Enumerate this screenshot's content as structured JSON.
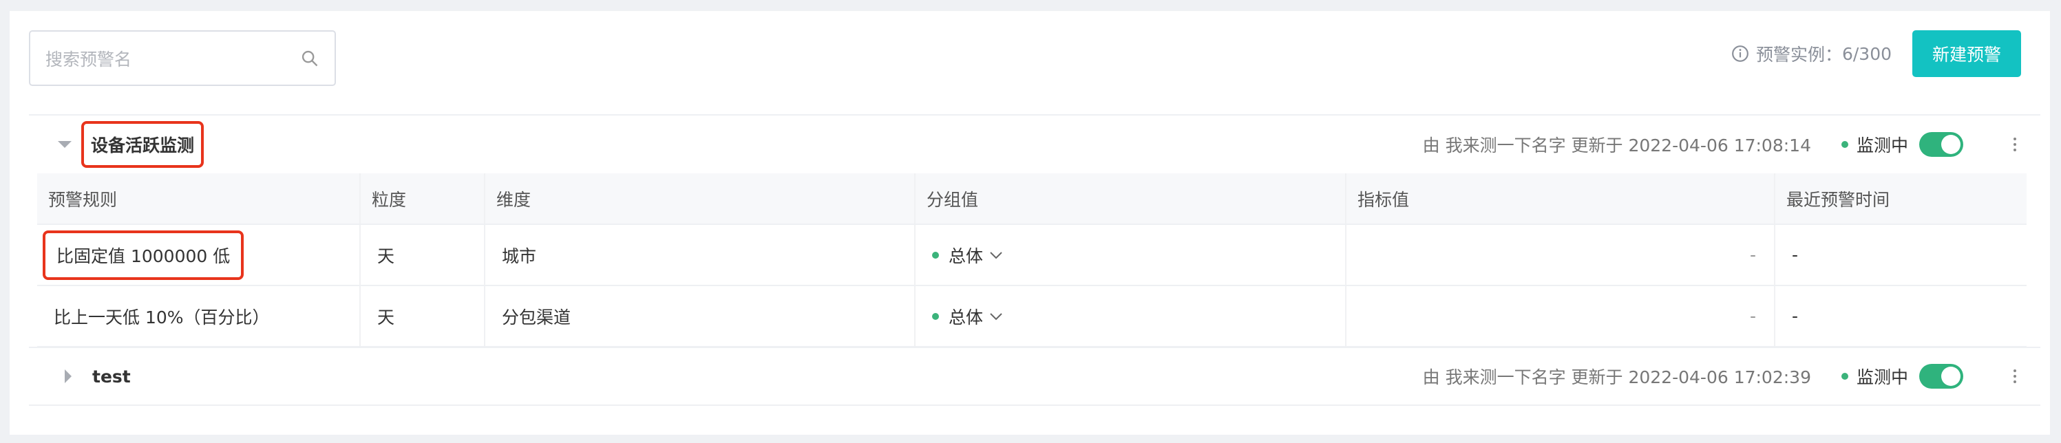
{
  "search": {
    "placeholder": "搜索预警名"
  },
  "header": {
    "instances_label": "预警实例：",
    "instances_value": "6/300",
    "new_button": "新建预警"
  },
  "groups": [
    {
      "name": "设备活跃监测",
      "updated": "由 我来测一下名字 更新于 2022-04-06 17:08:14",
      "status": "监测中"
    },
    {
      "name": "test",
      "updated": "由 我来测一下名字 更新于 2022-04-06 17:02:39",
      "status": "监测中"
    }
  ],
  "table": {
    "headers": [
      "预警规则",
      "粒度",
      "维度",
      "分组值",
      "指标值",
      "最近预警时间"
    ],
    "rows": [
      {
        "rule": "比固定值 1000000 低",
        "granularity": "天",
        "dimension": "城市",
        "group_value": "总体",
        "metric": "-",
        "last_alert": "-"
      },
      {
        "rule": "比上一天低 10%（百分比）",
        "granularity": "天",
        "dimension": "分包渠道",
        "group_value": "总体",
        "metric": "-",
        "last_alert": "-"
      }
    ]
  },
  "colors": {
    "accent": "#13c2c2",
    "toggle_on": "#2fb37d",
    "status_dot": "#3bb37b",
    "highlight": "#e8341c"
  }
}
